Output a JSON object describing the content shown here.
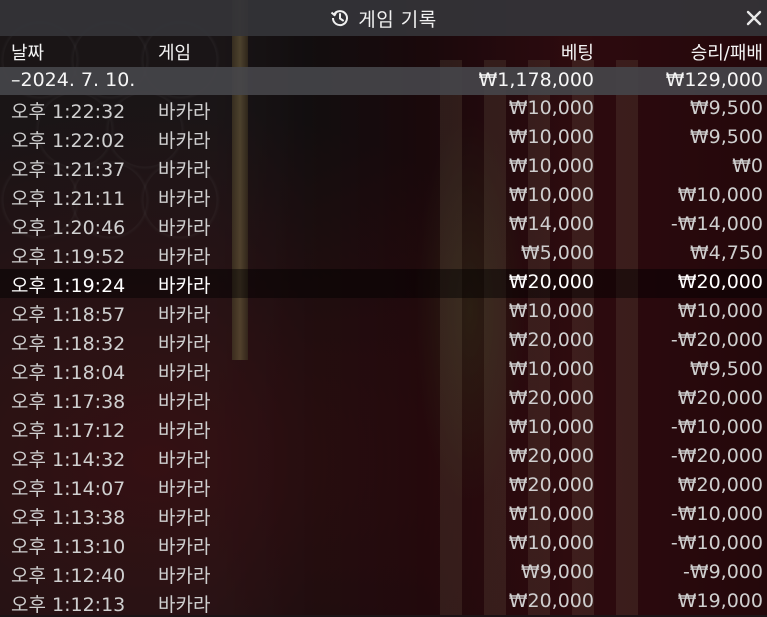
{
  "title": "게임 기록",
  "icons": {
    "history": "history-icon",
    "close": "close-icon"
  },
  "columns": {
    "date": "날짜",
    "game": "게임",
    "bet": "베팅",
    "win_loss": "승리/패배"
  },
  "date_group": {
    "label": "–2024. 7. 10.",
    "total_bet": "₩1,178,000",
    "total_win_loss": "₩129,000"
  },
  "rows": [
    {
      "time": "오후 1:22:32",
      "game": "바카라",
      "bet": "₩10,000",
      "result": "₩9,500"
    },
    {
      "time": "오후 1:22:02",
      "game": "바카라",
      "bet": "₩10,000",
      "result": "₩9,500"
    },
    {
      "time": "오후 1:21:37",
      "game": "바카라",
      "bet": "₩10,000",
      "result": "₩0"
    },
    {
      "time": "오후 1:21:11",
      "game": "바카라",
      "bet": "₩10,000",
      "result": "₩10,000"
    },
    {
      "time": "오후 1:20:46",
      "game": "바카라",
      "bet": "₩14,000",
      "result": "-₩14,000"
    },
    {
      "time": "오후 1:19:52",
      "game": "바카라",
      "bet": "₩5,000",
      "result": "₩4,750"
    },
    {
      "time": "오후 1:19:24",
      "game": "바카라",
      "bet": "₩20,000",
      "result": "₩20,000"
    },
    {
      "time": "오후 1:18:57",
      "game": "바카라",
      "bet": "₩10,000",
      "result": "₩10,000"
    },
    {
      "time": "오후 1:18:32",
      "game": "바카라",
      "bet": "₩20,000",
      "result": "-₩20,000"
    },
    {
      "time": "오후 1:18:04",
      "game": "바카라",
      "bet": "₩10,000",
      "result": "₩9,500"
    },
    {
      "time": "오후 1:17:38",
      "game": "바카라",
      "bet": "₩20,000",
      "result": "₩20,000"
    },
    {
      "time": "오후 1:17:12",
      "game": "바카라",
      "bet": "₩10,000",
      "result": "-₩10,000"
    },
    {
      "time": "오후 1:14:32",
      "game": "바카라",
      "bet": "₩20,000",
      "result": "-₩20,000"
    },
    {
      "time": "오후 1:14:07",
      "game": "바카라",
      "bet": "₩20,000",
      "result": "₩20,000"
    },
    {
      "time": "오후 1:13:38",
      "game": "바카라",
      "bet": "₩10,000",
      "result": "-₩10,000"
    },
    {
      "time": "오후 1:13:10",
      "game": "바카라",
      "bet": "₩10,000",
      "result": "-₩10,000"
    },
    {
      "time": "오후 1:12:40",
      "game": "바카라",
      "bet": "₩9,000",
      "result": "-₩9,000"
    },
    {
      "time": "오후 1:12:13",
      "game": "바카라",
      "bet": "₩20,000",
      "result": "₩19,000"
    }
  ],
  "highlighted_row_index": 6
}
